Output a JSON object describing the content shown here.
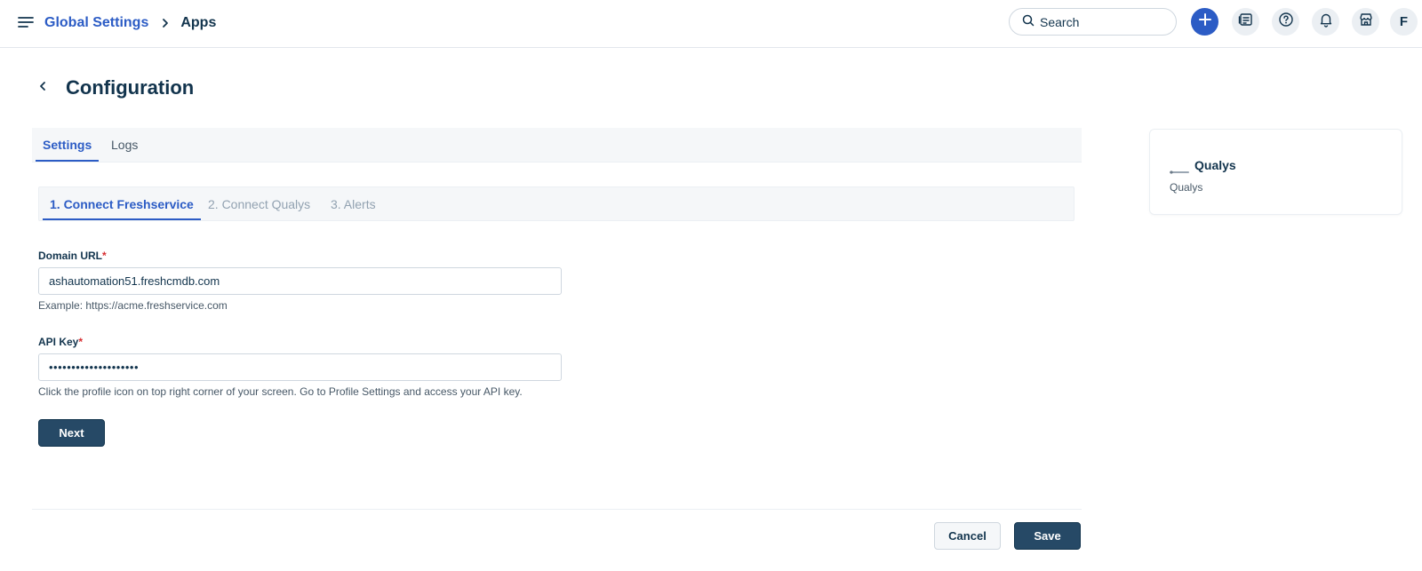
{
  "header": {
    "breadcrumb": {
      "parent": "Global Settings",
      "current": "Apps"
    },
    "search_placeholder": "Search",
    "avatar_initial": "F"
  },
  "page": {
    "title": "Configuration",
    "tabs": [
      {
        "label": "Settings",
        "active": true
      },
      {
        "label": "Logs",
        "active": false
      }
    ],
    "steps": [
      {
        "label": "1. Connect Freshservice",
        "active": true
      },
      {
        "label": "2. Connect Qualys",
        "active": false
      },
      {
        "label": "3. Alerts",
        "active": false
      }
    ]
  },
  "form": {
    "domain": {
      "label": "Domain URL",
      "required_mark": "*",
      "value": "ashautomation51.freshcmdb.com",
      "hint": "Example: https://acme.freshservice.com"
    },
    "api_key": {
      "label": "API Key",
      "required_mark": "*",
      "value": "••••••••••••••••••••",
      "hint": "Click the profile icon on top right corner of your screen. Go to Profile Settings and access your API key."
    },
    "next_label": "Next"
  },
  "footer": {
    "cancel_label": "Cancel",
    "save_label": "Save"
  },
  "app_card": {
    "name": "Qualys",
    "subtitle": "Qualys"
  },
  "icons": {
    "menu": "menu-icon",
    "chevron": "chevron-right-icon",
    "search": "search-icon",
    "add": "plus-icon",
    "catalog": "service-catalog-icon",
    "help": "help-icon",
    "bell": "bell-icon",
    "store": "marketplace-icon",
    "back": "chevron-left-icon"
  },
  "colors": {
    "accent": "#2c5cc5",
    "primary_button": "#264966",
    "required": "#d72d30"
  }
}
